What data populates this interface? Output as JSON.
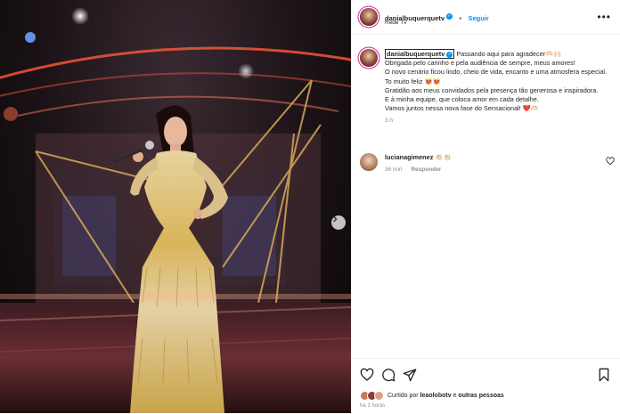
{
  "post": {
    "username": "danialbuquerquetv",
    "follow_label": "Seguir",
    "location": "Rede Tv",
    "more_label": "•••"
  },
  "caption": {
    "username": "danialbuquerquetv",
    "line1": "Passando aqui para agradecer🫶🏻🙌🏻",
    "line2": "Obrigada pelo carinho e pela audiência de sempre, meus amores!",
    "line3": "O novo cenário ficou lindo, cheio de vida, encanto e uma atmosfera especial. To muito feliz 😻😻",
    "line4": "Gratidão aos meus convidados pela presença tão generosa e inspiradora.",
    "line5": "E à minha equipe, que coloca amor em cada detalhe.",
    "line6": "Vamos juntos nessa nova fase do Sensacional! ❤️🫶🏻",
    "time": "3 h"
  },
  "comment": {
    "username": "lucianagimenez",
    "text": "👏🏻👏🏻",
    "time": "36 min",
    "reply_label": "Responder"
  },
  "likes": {
    "prefix": "Curtido por",
    "user": "leaolobotv",
    "connector": "e",
    "others": "outras pessoas"
  },
  "post_time": "há 3 horas",
  "colors": {
    "accent": "#0095f6",
    "gold": "#d9b24a",
    "stage_light": "#ff6a4a"
  },
  "icons": [
    "heart-icon",
    "comment-icon",
    "share-icon",
    "bookmark-icon",
    "verified-icon",
    "chevron-right-icon"
  ]
}
